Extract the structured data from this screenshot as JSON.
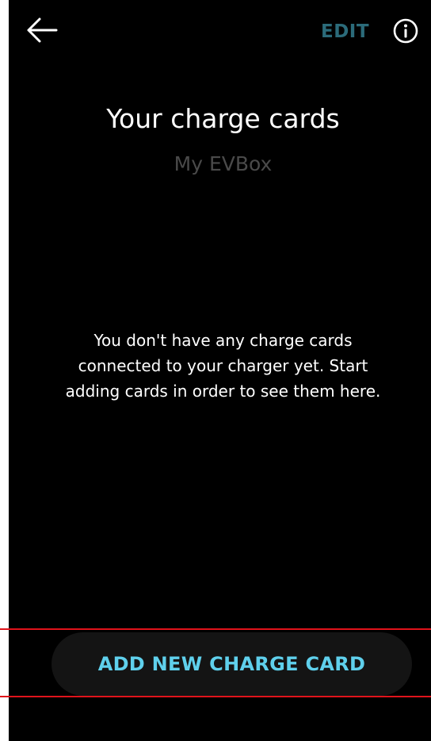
{
  "header": {
    "back_icon": "arrow-left-icon",
    "edit_label": "EDIT",
    "info_icon": "info-circle-icon"
  },
  "main": {
    "title": "Your charge cards",
    "subtitle": "My EVBox",
    "empty_message": "You don't have any charge cards connected to your charger yet. Start adding cards in order to see them here."
  },
  "footer": {
    "add_button_label": "ADD NEW CHARGE CARD"
  },
  "colors": {
    "background": "#000000",
    "edit_text": "#2b6b7a",
    "accent": "#5fd0ec",
    "button_bg": "#141414",
    "subtitle_text": "#4a4a4a",
    "highlight_lines": "#e0131b"
  }
}
